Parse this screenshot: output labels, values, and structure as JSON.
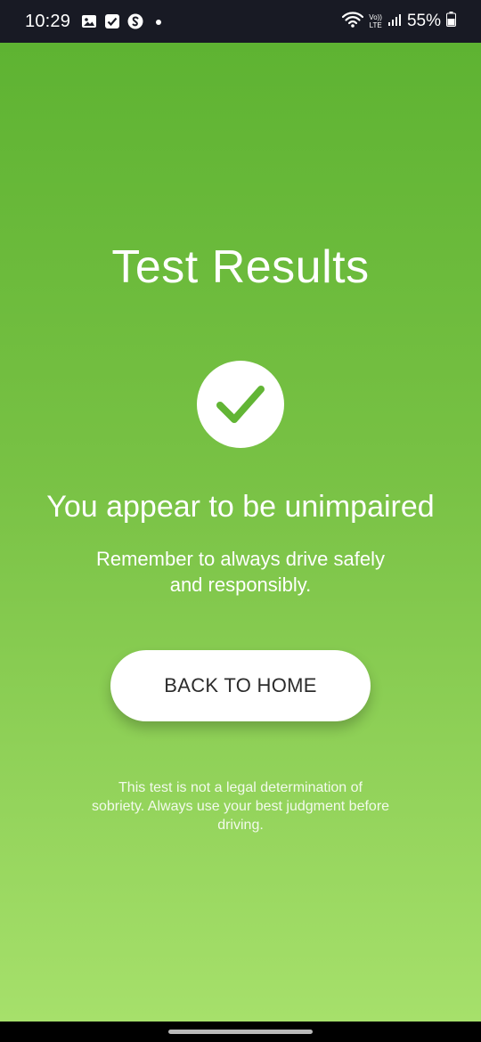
{
  "status_bar": {
    "time": "10:29",
    "notification_icons": [
      "gallery-icon",
      "checkbox-icon",
      "shazam-icon",
      "dot-icon"
    ],
    "volte_top": "Vo))",
    "volte_bottom": "LTE",
    "battery_percent": "55%"
  },
  "screen": {
    "title": "Test Results",
    "status_icon": "checkmark-icon",
    "headline": "You appear to be unimpaired",
    "subtext_line1": "Remember to always drive safely",
    "subtext_line2": "and responsibly.",
    "back_button_label": "BACK TO HOME",
    "disclaimer_line1": "This test is not a legal determination of",
    "disclaimer_line2": "sobriety. Always use your best judgment before",
    "disclaimer_line3": "driving."
  },
  "colors": {
    "gradient_top": "#5eb332",
    "gradient_bottom": "#a6e06b",
    "check_color": "#62b535",
    "button_text": "#2c2c2c"
  }
}
